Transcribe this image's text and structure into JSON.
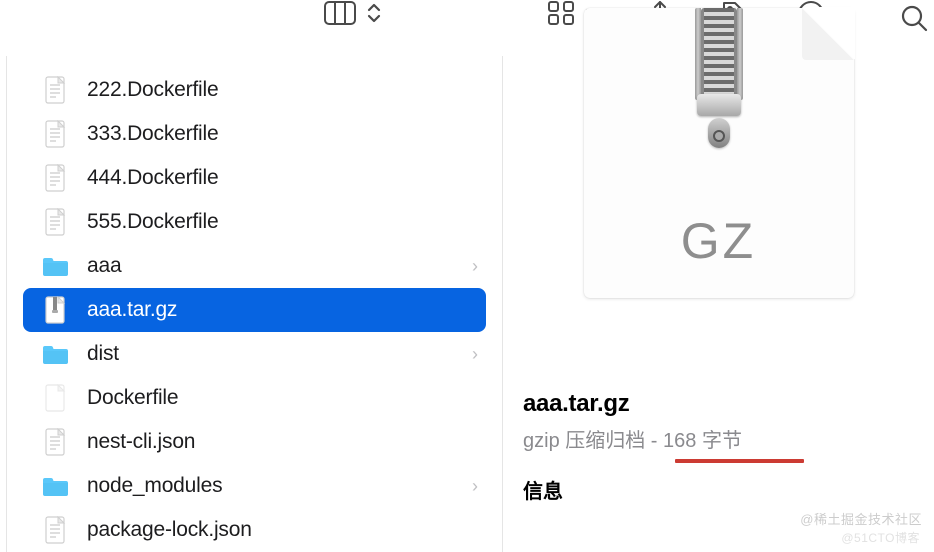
{
  "toolbar": {
    "icons": {
      "columns": "column-view-icon",
      "grid": "grid-view-icon",
      "share": "share-icon",
      "tag": "tag-icon",
      "more": "more-icon",
      "search": "search-icon"
    }
  },
  "file_list": [
    {
      "name": "222.Dockerfile",
      "type": "file",
      "selected": false
    },
    {
      "name": "333.Dockerfile",
      "type": "file",
      "selected": false
    },
    {
      "name": "444.Dockerfile",
      "type": "file",
      "selected": false
    },
    {
      "name": "555.Dockerfile",
      "type": "file",
      "selected": false
    },
    {
      "name": "aaa",
      "type": "folder",
      "selected": false,
      "expandable": true
    },
    {
      "name": "aaa.tar.gz",
      "type": "gz",
      "selected": true
    },
    {
      "name": "dist",
      "type": "folder",
      "selected": false,
      "expandable": true
    },
    {
      "name": "Dockerfile",
      "type": "blank",
      "selected": false
    },
    {
      "name": "nest-cli.json",
      "type": "file",
      "selected": false
    },
    {
      "name": "node_modules",
      "type": "folder",
      "selected": false,
      "expandable": true
    },
    {
      "name": "package-lock.json",
      "type": "file",
      "selected": false
    }
  ],
  "detail": {
    "gz_label": "GZ",
    "title": "aaa.tar.gz",
    "meta_type": "gzip 压缩归档",
    "meta_sep": " - ",
    "meta_size": "168 字节",
    "section_info": "信息"
  },
  "watermarks": {
    "w1": "@稀土掘金技术社区",
    "w2": "@51CTO博客"
  }
}
